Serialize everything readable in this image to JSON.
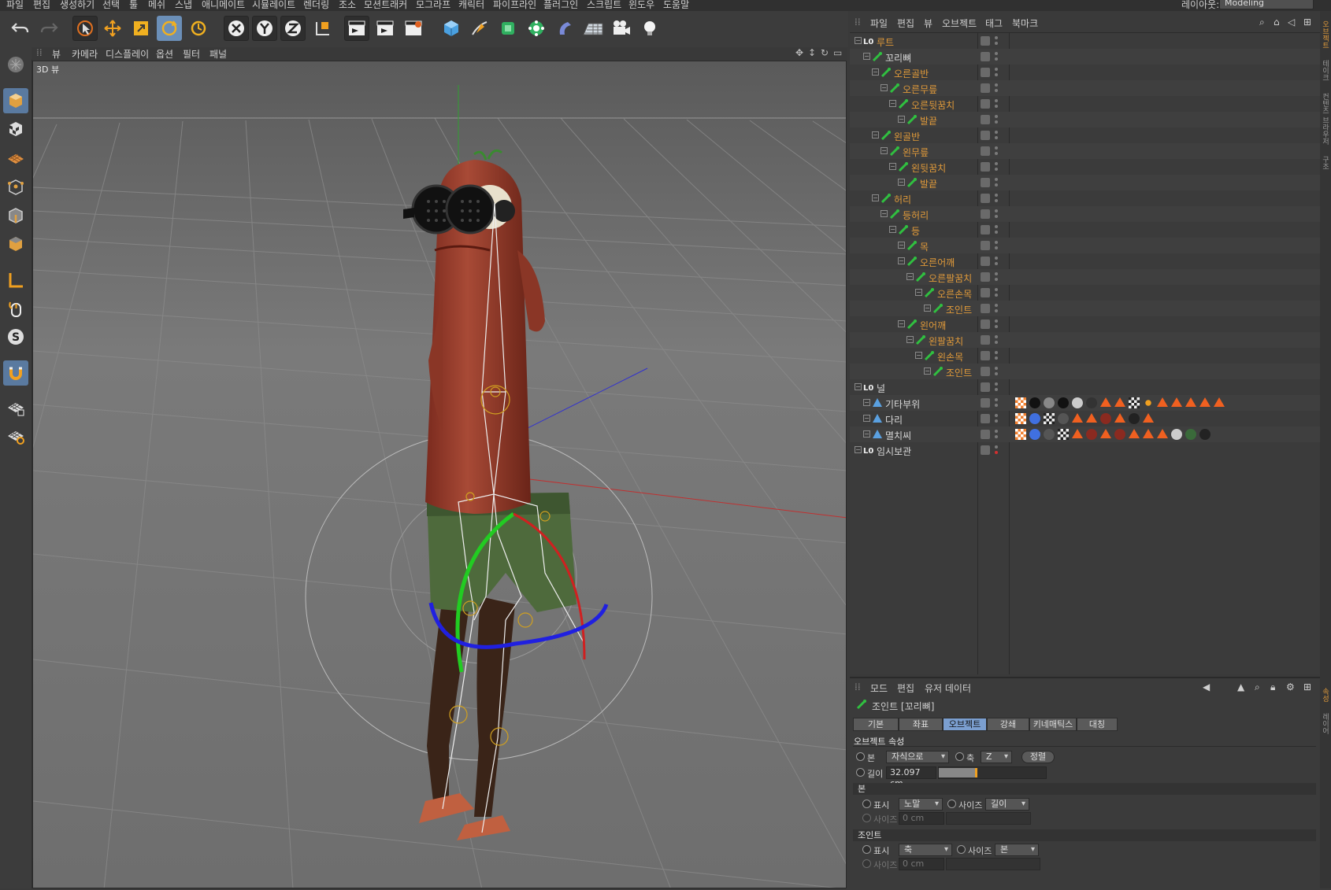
{
  "menubar": {
    "items": [
      "파일",
      "편집",
      "생성하기",
      "선택",
      "툴",
      "메쉬",
      "스냅",
      "애니메이트",
      "시뮬레이트",
      "렌더링",
      "조소",
      "모션트래커",
      "모그라프",
      "캐릭터",
      "파이프라인",
      "플러그인",
      "스크립트",
      "윈도우",
      "도움말"
    ],
    "layout_label": "레이아웃:",
    "layout_value": "Modeling"
  },
  "viewport": {
    "menu": [
      "뷰",
      "카메라",
      "디스플레이",
      "옵션",
      "필터",
      "패널"
    ],
    "label": "3D 뷰"
  },
  "object_manager": {
    "menu": [
      "파일",
      "편집",
      "뷰",
      "오브젝트",
      "태그",
      "북마크"
    ],
    "objects": [
      {
        "name": "루트",
        "type": "null",
        "indent": 0,
        "color": "orange"
      },
      {
        "name": "꼬리뼈",
        "type": "joint",
        "indent": 1,
        "color": "white"
      },
      {
        "name": "오른골반",
        "type": "joint",
        "indent": 2,
        "color": "orange"
      },
      {
        "name": "오른무릎",
        "type": "joint",
        "indent": 3,
        "color": "orange"
      },
      {
        "name": "오른뒷꿈치",
        "type": "joint",
        "indent": 4,
        "color": "orange"
      },
      {
        "name": "발끝",
        "type": "joint",
        "indent": 5,
        "color": "orange"
      },
      {
        "name": "왼골반",
        "type": "joint",
        "indent": 2,
        "color": "orange"
      },
      {
        "name": "왼무릎",
        "type": "joint",
        "indent": 3,
        "color": "orange"
      },
      {
        "name": "왼뒷꿈치",
        "type": "joint",
        "indent": 4,
        "color": "orange"
      },
      {
        "name": "발끝",
        "type": "joint",
        "indent": 5,
        "color": "orange"
      },
      {
        "name": "허리",
        "type": "joint",
        "indent": 2,
        "color": "orange"
      },
      {
        "name": "등허리",
        "type": "joint",
        "indent": 3,
        "color": "orange"
      },
      {
        "name": "등",
        "type": "joint",
        "indent": 4,
        "color": "orange"
      },
      {
        "name": "목",
        "type": "joint",
        "indent": 5,
        "color": "orange"
      },
      {
        "name": "오른어깨",
        "type": "joint",
        "indent": 5,
        "color": "orange"
      },
      {
        "name": "오른팔꿈치",
        "type": "joint",
        "indent": 6,
        "color": "orange"
      },
      {
        "name": "오른손목",
        "type": "joint",
        "indent": 7,
        "color": "orange"
      },
      {
        "name": "조인트",
        "type": "joint",
        "indent": 8,
        "color": "orange"
      },
      {
        "name": "왼어깨",
        "type": "joint",
        "indent": 5,
        "color": "orange"
      },
      {
        "name": "왼팔꿈치",
        "type": "joint",
        "indent": 6,
        "color": "orange"
      },
      {
        "name": "왼손목",
        "type": "joint",
        "indent": 7,
        "color": "orange"
      },
      {
        "name": "조인트",
        "type": "joint",
        "indent": 8,
        "color": "orange"
      },
      {
        "name": "널",
        "type": "null",
        "indent": 0,
        "color": "white"
      },
      {
        "name": "기타부위",
        "type": "poly",
        "indent": 1,
        "color": "white"
      },
      {
        "name": "다리",
        "type": "poly",
        "indent": 1,
        "color": "white"
      },
      {
        "name": "멸치씨",
        "type": "poly",
        "indent": 1,
        "color": "white"
      },
      {
        "name": "임시보관",
        "type": "null",
        "indent": 0,
        "color": "white"
      }
    ]
  },
  "attribute_manager": {
    "menu": [
      "모드",
      "편집",
      "유저 데이터"
    ],
    "object_title": "조인트 [꼬리뼈]",
    "tabs": [
      "기본",
      "좌표",
      "오브젝트",
      "강쇄",
      "키네매틱스",
      "대칭"
    ],
    "active_tab": "오브젝트",
    "section_object": "오브젝트 속성",
    "bone_label": "본",
    "bone_value": "자식으로",
    "axis_label": "축",
    "axis_value": "Z",
    "align_button": "정렬",
    "length_label": "길이",
    "length_value": "32.097 cm",
    "section_bone": "본",
    "display_label": "표시",
    "bone_display_value": "노말",
    "size_label": "사이즈",
    "bone_size_value": "길이",
    "bone_size_field": "0 cm",
    "section_joint": "조인트",
    "joint_display_value": "축",
    "joint_size_value": "본",
    "joint_size_field": "0 cm"
  },
  "right_strip": [
    "오브젝트",
    "테이크",
    "컨텐츠 브라우저",
    "구조"
  ],
  "right_strip2": [
    "속성",
    "레이어"
  ]
}
